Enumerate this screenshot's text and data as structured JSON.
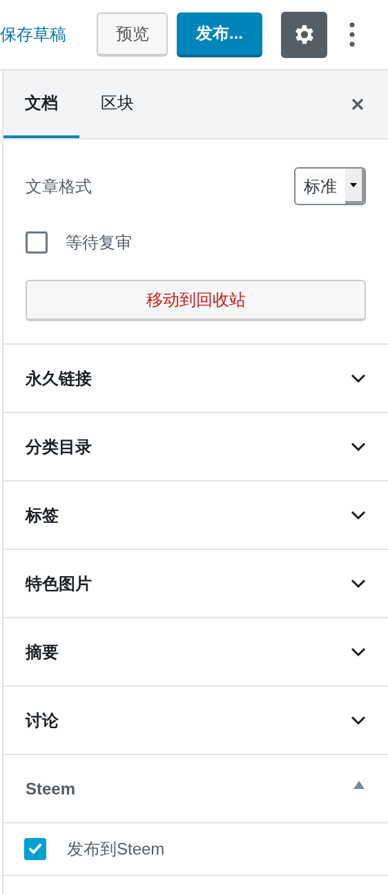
{
  "toolbar": {
    "save_draft": "保存草稿",
    "preview": "预览",
    "publish": "发布...",
    "settings_selected": true
  },
  "tabs": [
    {
      "label": "文档",
      "selected": true
    },
    {
      "label": "区块",
      "selected": false
    }
  ],
  "status": {
    "format_label": "文章格式",
    "format_value": "标准",
    "pending_review": {
      "label": "等待复审",
      "checked": false
    },
    "trash": "移动到回收站"
  },
  "panels": [
    {
      "title": "永久链接",
      "expanded": false
    },
    {
      "title": "分类目录",
      "expanded": false
    },
    {
      "title": "标签",
      "expanded": false
    },
    {
      "title": "特色图片",
      "expanded": false
    },
    {
      "title": "摘要",
      "expanded": false
    },
    {
      "title": "讨论",
      "expanded": false
    },
    {
      "title": "Steem",
      "expanded": true,
      "options": [
        {
          "label": "发布到Steem",
          "checked": true
        }
      ]
    }
  ]
}
